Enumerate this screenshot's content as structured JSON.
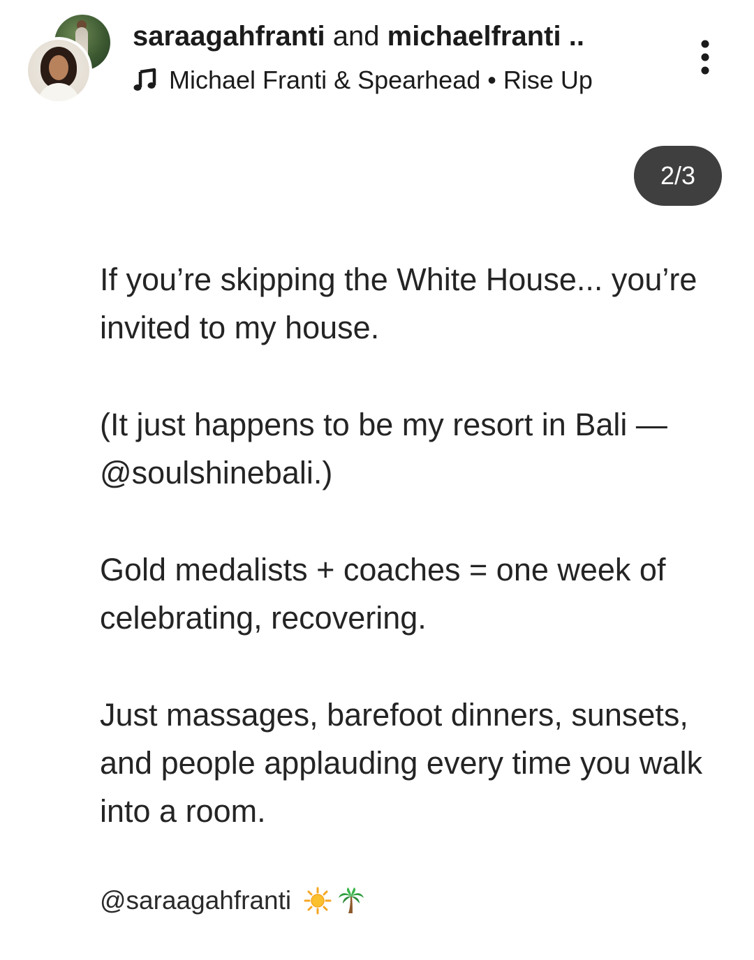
{
  "header": {
    "user_one": "saraagahfranti",
    "connector": " and ",
    "user_two": "michaelfranti ..",
    "music_icon": "music-note-icon",
    "song": "Michael Franti & Spearhead • Rise Up",
    "more_icon": "more-vertical-icon"
  },
  "pager": {
    "label": "2/3"
  },
  "post": {
    "paragraphs": [
      "If you’re skipping the White House... you’re invited to my house.",
      "(It just happens to be my resort in Bali — @soulshinebali.)",
      "Gold medalists + coaches = one week of celebrating, recovering.",
      "Just massages, barefoot dinners, sunsets, and people applauding every time you walk into a room."
    ],
    "signature": "@saraagahfranti",
    "signature_emojis": [
      "sun-emoji",
      "palm-tree-emoji"
    ]
  },
  "colors": {
    "pill_background": "#3f3f3f",
    "text": "#242424",
    "background": "#ffffff"
  }
}
